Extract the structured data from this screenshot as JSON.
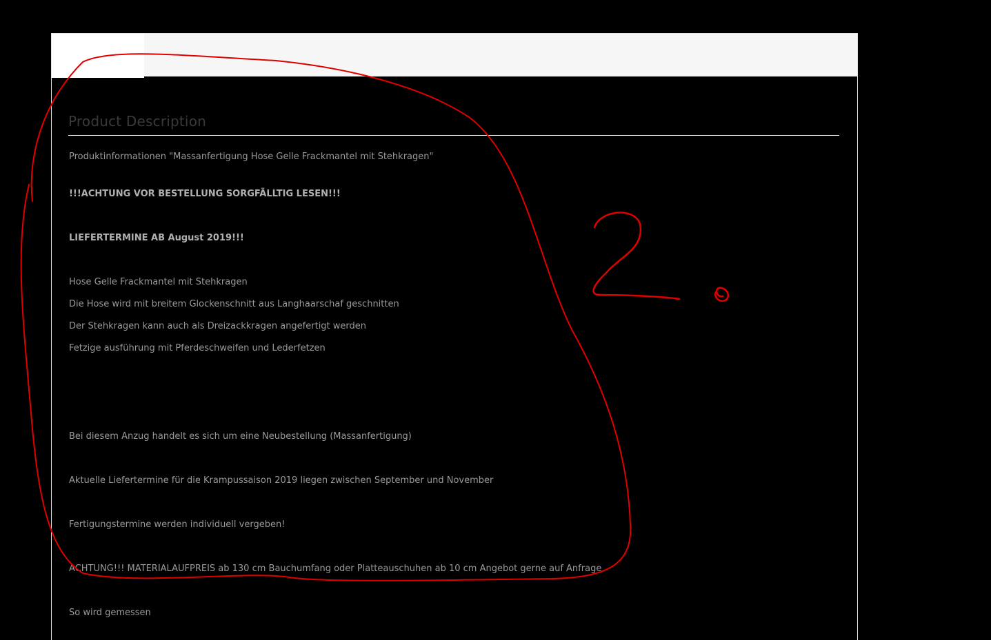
{
  "description": {
    "heading": "Product Description",
    "lines": [
      "Produktinformationen \"Massanfertigung Hose Gelle Frackmantel mit Stehkragen\"",
      "!!!ACHTUNG VOR BESTELLUNG SORGFÄLLTIG LESEN!!!",
      "LIEFERTERMINE AB August 2019!!!",
      "Hose Gelle Frackmantel mit Stehkragen",
      "Die Hose wird mit breitem Glockenschnitt aus Langhaarschaf geschnitten",
      "Der Stehkragen kann auch als Dreizackkragen angefertigt werden",
      "Fetzige ausführung mit Pferdeschweifen und Lederfetzen",
      "Bei diesem Anzug handelt es sich um eine Neubestellung (Massanfertigung)",
      "Aktuelle Liefertermine für die Krampussaison 2019 liegen zwischen September und November",
      "Fertigungstermine werden individuell vergeben!",
      "ACHTUNG!!! MATERIALAUFPREIS  ab 130 cm Bauchumfang  oder Platteauschuhen ab 10 cm  Angebot gerne auf Anfrage",
      "So wird gemessen"
    ]
  },
  "annotation": {
    "label": "2.",
    "color": "#e00000"
  }
}
